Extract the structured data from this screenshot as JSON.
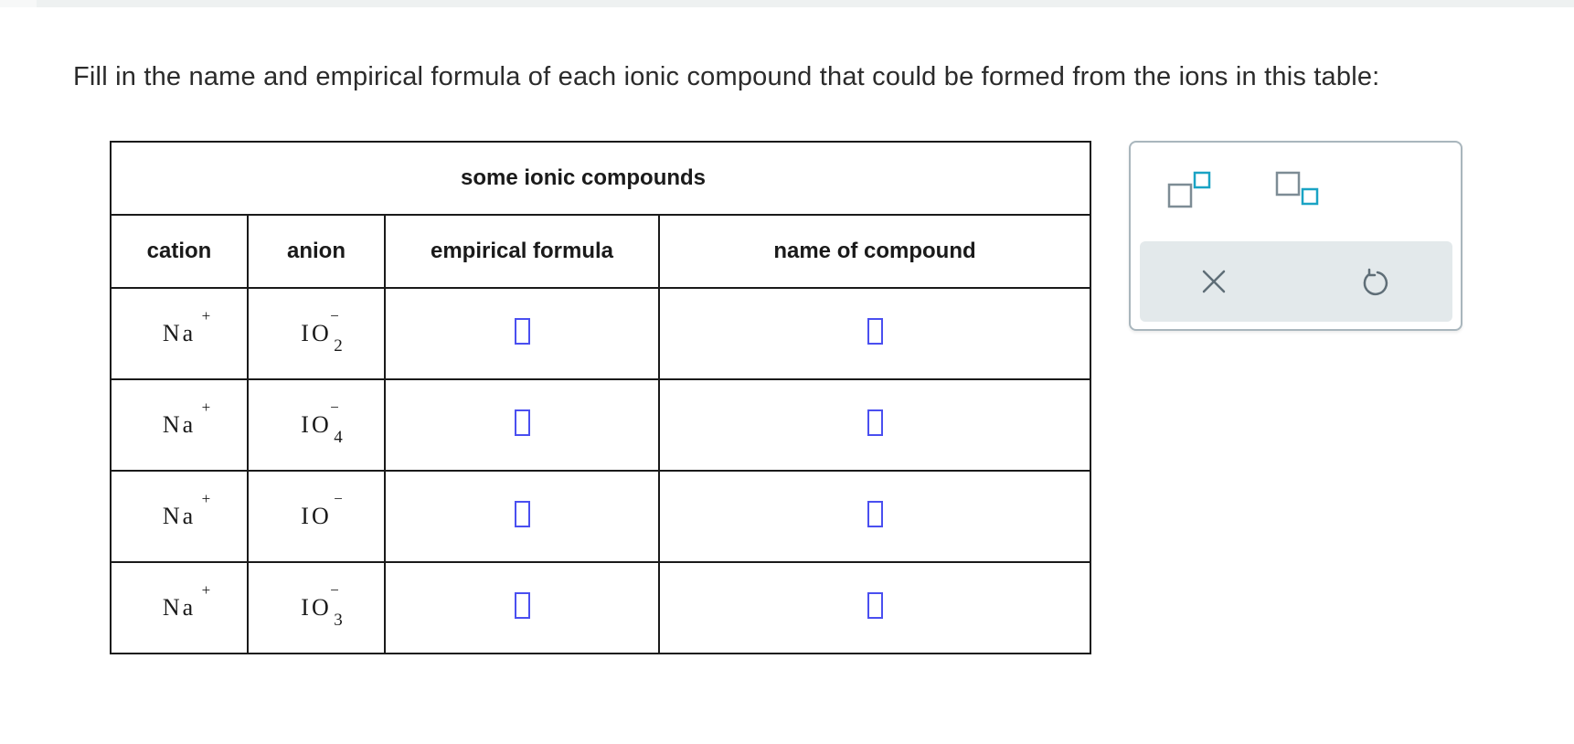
{
  "prompt": "Fill in the name and empirical formula of each ionic compound that could be formed from the ions in this table:",
  "table": {
    "caption": "some ionic compounds",
    "headers": {
      "cation": "cation",
      "anion": "anion",
      "formula": "empirical formula",
      "name": "name of compound"
    },
    "rows": [
      {
        "cation": "Na",
        "cation_charge": "+",
        "anion": "IO",
        "anion_sub": "2",
        "anion_charge": "−"
      },
      {
        "cation": "Na",
        "cation_charge": "+",
        "anion": "IO",
        "anion_sub": "4",
        "anion_charge": "−"
      },
      {
        "cation": "Na",
        "cation_charge": "+",
        "anion": "IO",
        "anion_sub": "",
        "anion_charge": "−"
      },
      {
        "cation": "Na",
        "cation_charge": "+",
        "anion": "IO",
        "anion_sub": "3",
        "anion_charge": "−"
      }
    ]
  },
  "toolbar": {
    "superscript_icon": "superscript-icon",
    "subscript_icon": "subscript-icon",
    "clear_icon": "close-icon",
    "undo_icon": "undo-icon",
    "clear_glyph": "×"
  },
  "colors": {
    "answer_box_border": "#4a4ff0",
    "tool_accent": "#1aa3c4",
    "tool_gray": "#7d8c95",
    "tool_row_bg": "#e3e9eb"
  }
}
